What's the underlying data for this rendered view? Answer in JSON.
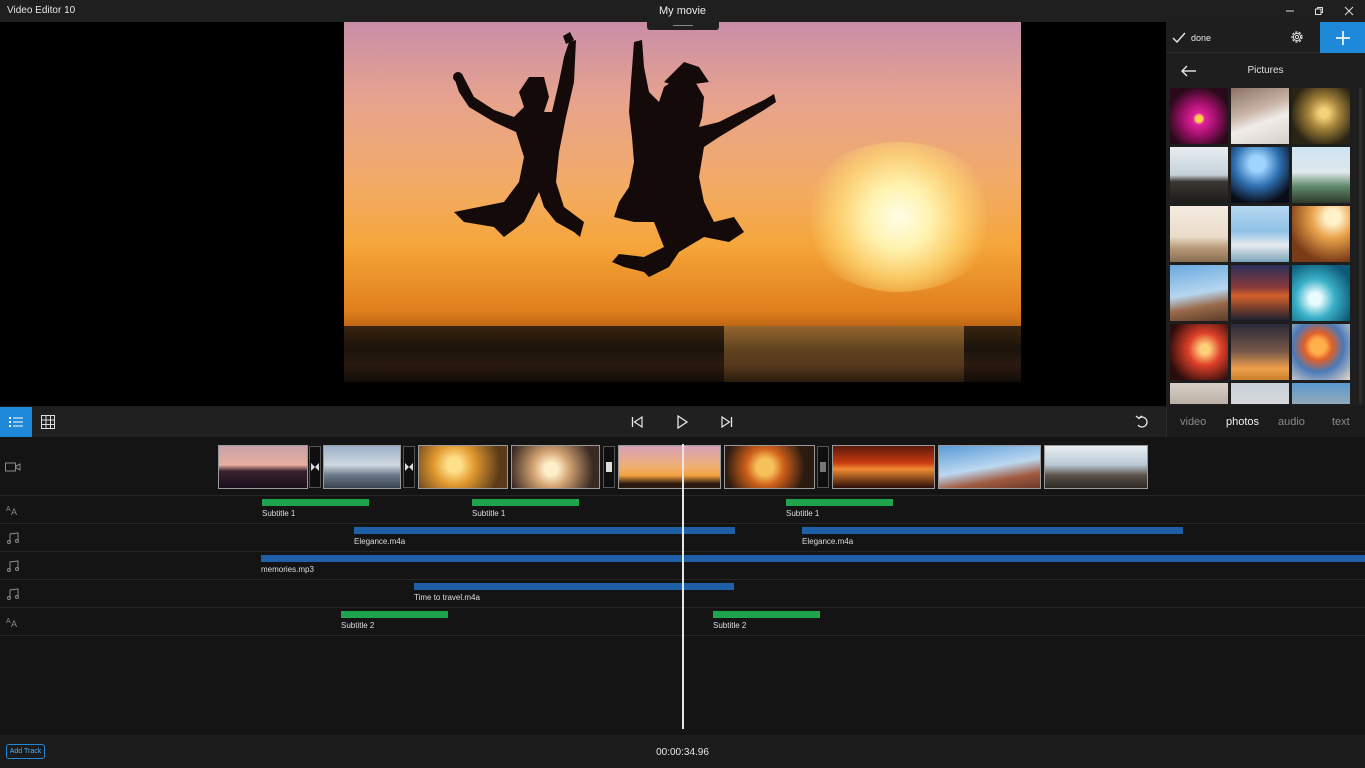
{
  "window": {
    "app_title": "Video Editor 10",
    "doc_title": "My movie",
    "minimize_icon": "minimize-icon",
    "restore_icon": "restore-icon",
    "close_icon": "close-icon"
  },
  "side_panel": {
    "done_label": "done",
    "settings_icon": "gear-icon",
    "add_icon": "plus-icon",
    "back_icon": "arrow-left-icon",
    "title": "Pictures",
    "tabs": [
      {
        "label": "video",
        "active": false
      },
      {
        "label": "photos",
        "active": true
      },
      {
        "label": "audio",
        "active": false
      },
      {
        "label": "text",
        "active": false
      }
    ]
  },
  "toolbar": {
    "list_view_icon": "list-icon",
    "grid_view_icon": "grid-icon",
    "skip_back_icon": "skip-to-start-icon",
    "play_icon": "play-icon",
    "skip_forward_icon": "skip-to-end-icon",
    "undo_icon": "undo-icon"
  },
  "timeline": {
    "tracks": [
      {
        "type": "video",
        "icon": "video-camera-icon"
      },
      {
        "type": "text",
        "icon": "text-icon",
        "items": [
          {
            "label": "Subtitle 1"
          },
          {
            "label": "Subtitle 1"
          },
          {
            "label": "Subtitle 1"
          }
        ]
      },
      {
        "type": "audio",
        "icon": "music-note-icon",
        "items": [
          {
            "label": "Elegance.m4a"
          },
          {
            "label": "Elegance.m4a"
          }
        ]
      },
      {
        "type": "audio",
        "icon": "music-note-icon",
        "items": [
          {
            "label": "memories.mp3"
          }
        ]
      },
      {
        "type": "audio",
        "icon": "music-note-icon",
        "items": [
          {
            "label": "Time to travel.m4a"
          }
        ]
      },
      {
        "type": "text",
        "icon": "text-icon",
        "items": [
          {
            "label": "Subtitle 2"
          },
          {
            "label": "Subtitle 2"
          }
        ]
      }
    ]
  },
  "status": {
    "add_track_label": "Add Track",
    "current_time": "00:00:34.96"
  },
  "colors": {
    "accent": "#1e88d9",
    "subtitle_bar": "#1fa34c",
    "audio_bar": "#1f5fa8"
  }
}
